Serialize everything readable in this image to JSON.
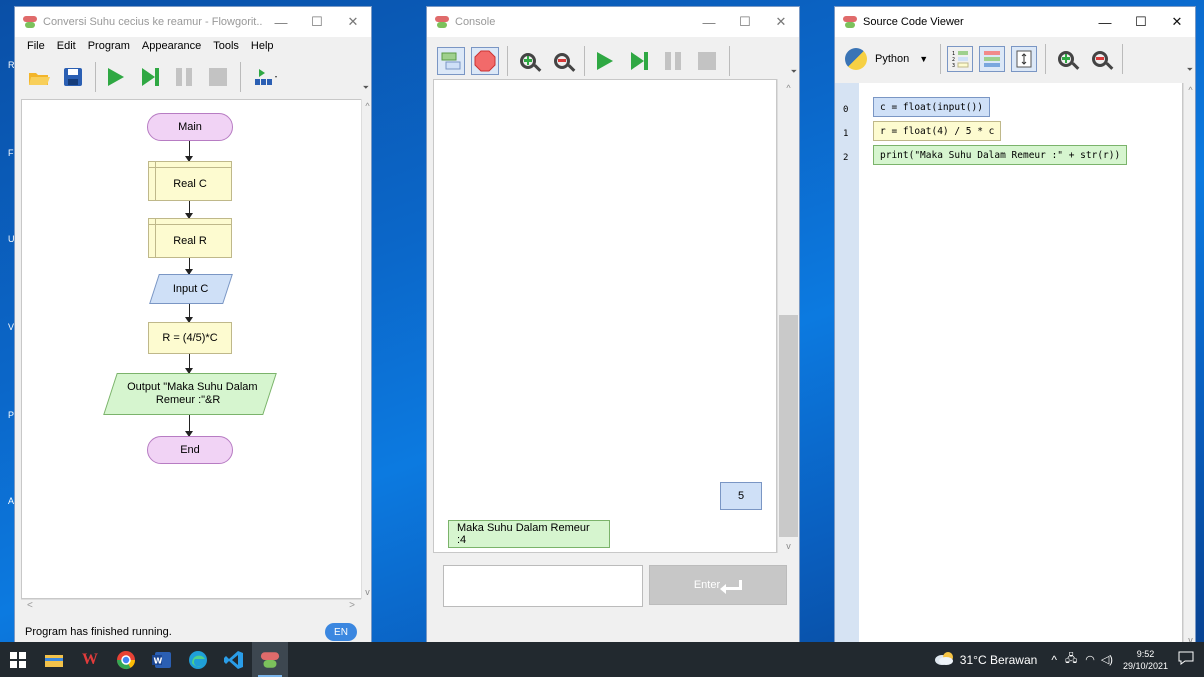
{
  "desktop": {
    "edge_labels": [
      "R",
      "Fl",
      "U",
      "Vi",
      "Pi",
      "A"
    ]
  },
  "flowgorithm": {
    "title": "Conversi Suhu cecius ke reamur - Flowgorit...",
    "menu": [
      "File",
      "Edit",
      "Program",
      "Appearance",
      "Tools",
      "Help"
    ],
    "nodes": {
      "main": "Main",
      "real_c": "Real C",
      "real_r": "Real R",
      "input_c": "Input C",
      "assign": "R = (4/5)*C",
      "output_line1": "Output \"Maka Suhu Dalam",
      "output_line2": "Remeur :\"&R",
      "end": "End"
    },
    "status": "Program has finished running.",
    "language": "EN"
  },
  "console": {
    "title": "Console",
    "input_bubble": "5",
    "output_bubble": "Maka Suhu Dalam Remeur :4",
    "enter_label": "Enter"
  },
  "source_viewer": {
    "title": "Source Code Viewer",
    "language": "Python",
    "lines": [
      {
        "num": "0",
        "code": "c = float(input())"
      },
      {
        "num": "1",
        "code": "r = float(4) / 5 * c"
      },
      {
        "num": "2",
        "code": "print(\"Maka Suhu Dalam Remeur :\" + str(r))"
      }
    ]
  },
  "taskbar": {
    "weather": "31°C  Berawan",
    "time": "9:52",
    "date": "29/10/2021"
  },
  "colors": {
    "desktop": "#0b67c9",
    "terminal": "#f1d3f5",
    "declare": "#fdfbd0",
    "input": "#cfe0f7",
    "output": "#d6f5cf",
    "run": "#2fa843",
    "taskbar": "#22292f"
  }
}
